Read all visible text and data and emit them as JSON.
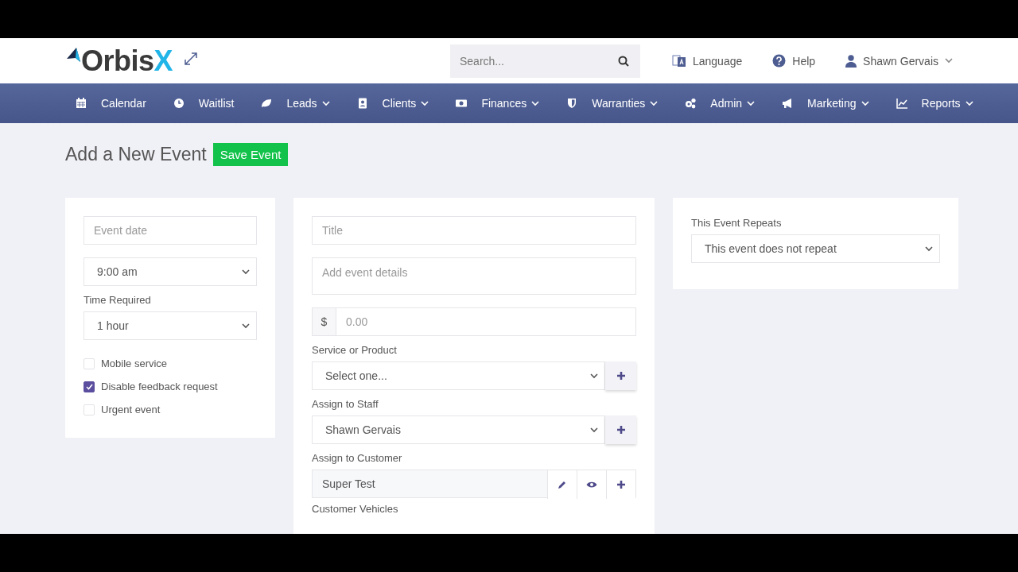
{
  "logo": {
    "text": "Orbis",
    "accent": "X"
  },
  "search": {
    "placeholder": "Search..."
  },
  "header_links": [
    {
      "label": "Language",
      "dropdown": false
    },
    {
      "label": "Help",
      "dropdown": false
    },
    {
      "label": "Shawn Gervais",
      "dropdown": true
    }
  ],
  "nav": [
    {
      "label": "Calendar",
      "dropdown": false
    },
    {
      "label": "Waitlist",
      "dropdown": false
    },
    {
      "label": "Leads",
      "dropdown": true
    },
    {
      "label": "Clients",
      "dropdown": true
    },
    {
      "label": "Finances",
      "dropdown": true
    },
    {
      "label": "Warranties",
      "dropdown": true
    },
    {
      "label": "Admin",
      "dropdown": true
    },
    {
      "label": "Marketing",
      "dropdown": true
    },
    {
      "label": "Reports",
      "dropdown": true
    }
  ],
  "page": {
    "title": "Add a New Event",
    "save_button": "Save Event"
  },
  "left_card": {
    "date_placeholder": "Event date",
    "time": "9:00 am",
    "duration_label": "Time Required",
    "duration": "1 hour",
    "options": [
      {
        "label": "Mobile service",
        "checked": false
      },
      {
        "label": "Disable feedback request",
        "checked": true
      },
      {
        "label": "Urgent event",
        "checked": false
      }
    ]
  },
  "middle_card": {
    "title_placeholder": "Title",
    "details_placeholder": "Add event details",
    "currency": "$",
    "price_placeholder": "0.00",
    "service_label": "Service or Product",
    "service": "Select one...",
    "staff_label": "Assign to Staff",
    "staff": "Shawn Gervais",
    "customer_label": "Assign to Customer",
    "customer": "Super Test",
    "vehicles_label": "Customer Vehicles"
  },
  "right_card": {
    "repeat_label": "This Event Repeats",
    "repeat": "This event does not repeat"
  }
}
